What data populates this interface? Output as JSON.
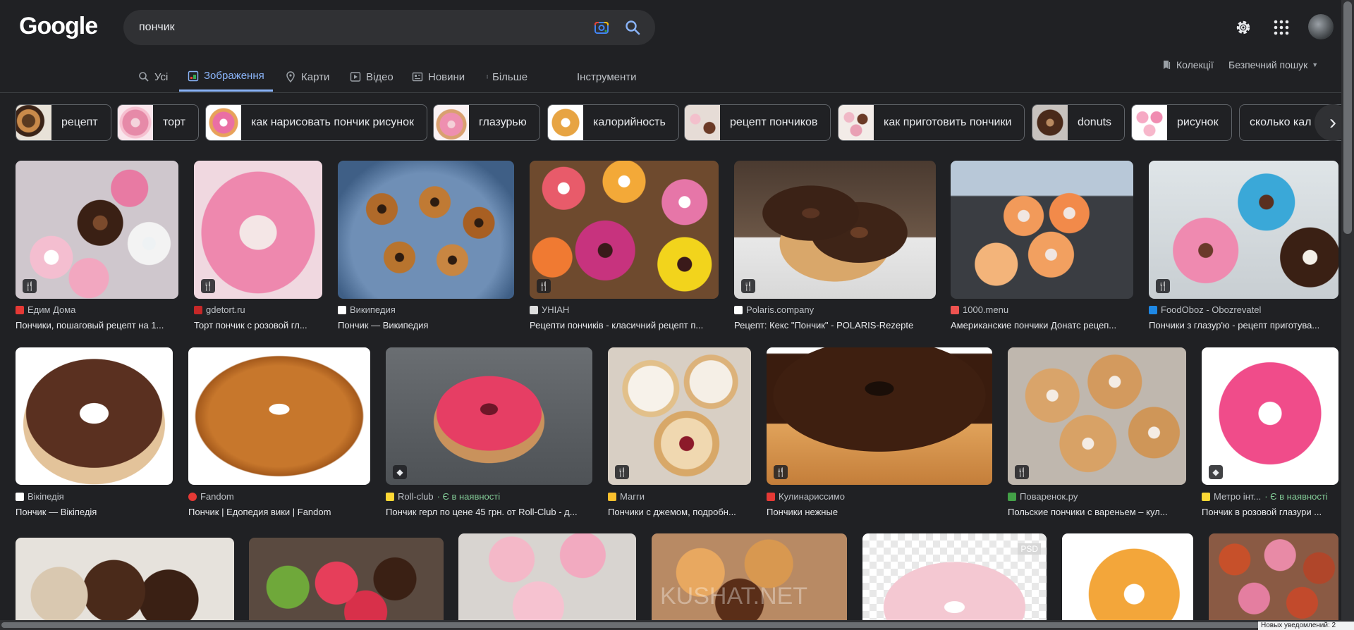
{
  "header": {
    "logo": "Google",
    "query": "пончик"
  },
  "tabs": [
    {
      "label": "Усі",
      "icon": "search-icon"
    },
    {
      "label": "Зображення",
      "icon": "image-icon"
    },
    {
      "label": "Карти",
      "icon": "map-pin-icon"
    },
    {
      "label": "Відео",
      "icon": "play-icon"
    },
    {
      "label": "Новини",
      "icon": "news-icon"
    },
    {
      "label": "Більше",
      "icon": "more-vert-icon"
    },
    {
      "label": "Інструменти",
      "icon": ""
    }
  ],
  "right_links": {
    "collections": "Колекції",
    "safe_search": "Безпечний пошук"
  },
  "chips": [
    "рецепт",
    "торт",
    "как нарисовать пончик рисунок",
    "глазурью",
    "калорийность",
    "рецепт пончиков",
    "как приготовить пончики",
    "donuts",
    "рисунок",
    "сколько кал"
  ],
  "results": [
    {
      "source": "Едим Дома",
      "title": "Пончики, пошаговый рецепт на 1...",
      "stock": ""
    },
    {
      "source": "gdetort.ru",
      "title": "Торт пончик с розовой гл...",
      "stock": ""
    },
    {
      "source": "Википедия",
      "title": "Пончик — Википедия",
      "stock": ""
    },
    {
      "source": "УНІАН",
      "title": "Рецепти пончиків - класичний рецепт п...",
      "stock": ""
    },
    {
      "source": "Polaris.company",
      "title": "Рецепт: Кекс \"Пончик\" - POLARIS-Rezepte",
      "stock": ""
    },
    {
      "source": "1000.menu",
      "title": "Американские пончики Донатс рецеп...",
      "stock": ""
    },
    {
      "source": "FoodOboz - Obozrevatel",
      "title": "Пончики з глазур'ю - рецепт приготува...",
      "stock": ""
    },
    {
      "source": "Вікіпедія",
      "title": "Пончик — Вікіпедія",
      "stock": ""
    },
    {
      "source": "Fandom",
      "title": "Пончик | Едопедия вики | Fandom",
      "stock": ""
    },
    {
      "source": "Roll-club",
      "title": "Пончик герл по цене 45 грн. от Roll-Club - д...",
      "stock": " · Є в наявності"
    },
    {
      "source": "Магги",
      "title": "Пончики с джемом, подробн...",
      "stock": ""
    },
    {
      "source": "Кулинариссимо",
      "title": "Пончики нежные",
      "stock": ""
    },
    {
      "source": "Поваренок.ру",
      "title": "Польские пончики с вареньем – кул...",
      "stock": ""
    },
    {
      "source": "Метро інт...",
      "title": "Пончик в розовой глазури ...",
      "stock": " · Є в наявності"
    }
  ],
  "watermark": "KUSHAT.NET",
  "psd_label": "PSD",
  "notice": "Новых уведомлений: 2",
  "colors": {
    "background": "#202124",
    "accent": "#8ab4f8",
    "in_stock": "#81c995"
  }
}
